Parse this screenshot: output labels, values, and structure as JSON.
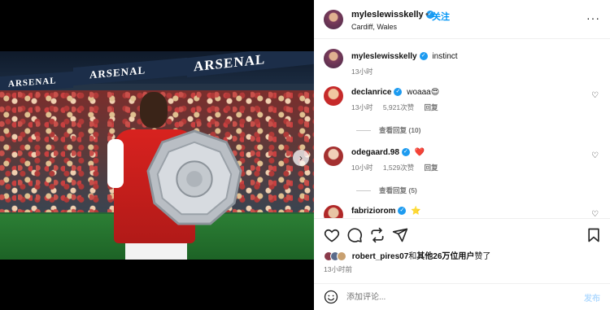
{
  "post": {
    "author": "myleslewisskelly",
    "follow_label": "关注",
    "separator": "•",
    "location": "Cardiff, Wales",
    "more_label": "···",
    "caption": "instinct",
    "caption_time": "13小时",
    "photo_banners": [
      "ARSENAL",
      "ARSENAL",
      "ARSENAL"
    ],
    "carousel_next": "›"
  },
  "comments": [
    {
      "username": "declanrice",
      "text": "woaaa😍",
      "time": "13小时",
      "likes": "5,921次赞",
      "reply": "回复",
      "view_replies": "查看回复 (10)",
      "heart": "♡"
    },
    {
      "username": "odegaard.98",
      "text": "❤️",
      "time": "10小时",
      "likes": "1,529次赞",
      "reply": "回复",
      "view_replies": "查看回复 (5)",
      "heart": "♡"
    },
    {
      "username": "fabriziorom",
      "text": "⭐",
      "heart": "♡"
    }
  ],
  "likes_summary": {
    "first_user": "robert_pires07",
    "connector": "和",
    "others": "其他26万位用户",
    "suffix": "赞了"
  },
  "post_time": "13小时前",
  "comment_box": {
    "placeholder": "添加评论...",
    "post_label": "发布"
  },
  "colors": {
    "accent": "#0095f6",
    "verified": "#1d9bf0",
    "muted": "#737373",
    "post_disabled": "#b3dbff"
  },
  "icons": [
    "heart-icon",
    "comment-icon",
    "repost-icon",
    "share-icon",
    "bookmark-icon",
    "emoji-icon",
    "verified-icon",
    "more-icon"
  ]
}
